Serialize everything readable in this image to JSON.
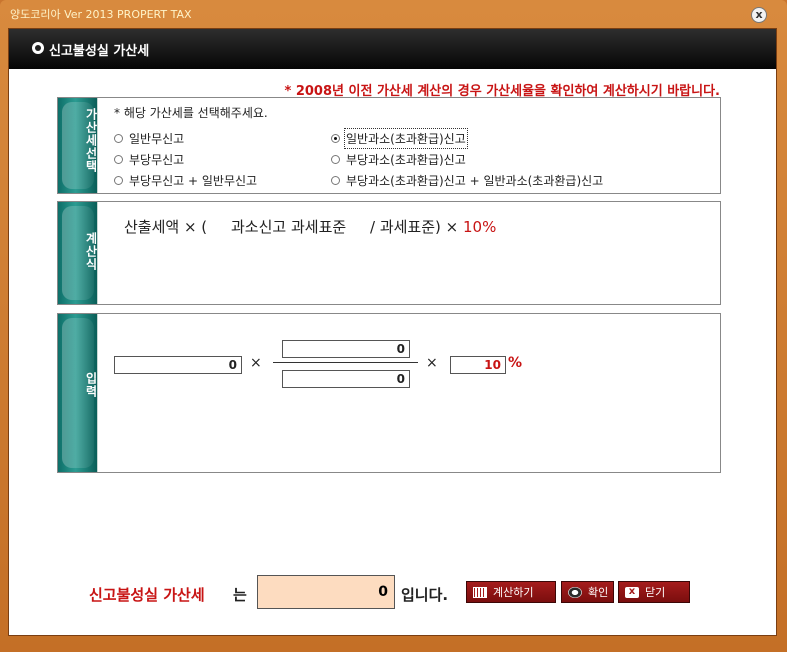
{
  "window": {
    "title": "양도코리아 Ver 2013 PROPERT TAX",
    "close_glyph": "x"
  },
  "header": {
    "title": "신고불성실 가산세"
  },
  "notice": "* 2008년 이전 가산세 계산의 경우 가산세율을 확인하여 계산하시기 바랍니다.",
  "selection_panel": {
    "tab_label": "가산세선택",
    "instruction": "* 해당 가산세를 선택해주세요.",
    "options": [
      {
        "label": "일반무신고",
        "checked": false
      },
      {
        "label": "일반과소(초과환급)신고",
        "checked": true
      },
      {
        "label": "부당무신고",
        "checked": false
      },
      {
        "label": "부당과소(초과환급)신고",
        "checked": false
      },
      {
        "label": "부당무신고 + 일반무신고",
        "checked": false
      },
      {
        "label": "부당과소(초과환급)신고 + 일반과소(초과환급)신고",
        "checked": false
      }
    ]
  },
  "formula_panel": {
    "tab_label": "계산식",
    "formula_prefix": "산출세액 × (     과소신고 과세표준     / 과세표준) × ",
    "formula_rate": "10%"
  },
  "input_panel": {
    "tab_label": "입력",
    "tax_amount": "0",
    "multiply_1": "×",
    "numerator": "0",
    "denominator": "0",
    "multiply_2": "×",
    "rate_value": "10",
    "rate_unit": "%"
  },
  "footer": {
    "label": "신고불성실 가산세",
    "particle": "는",
    "result": "0",
    "suffix": "입니다.",
    "calculate_button": "계산하기",
    "confirm_button": "확인",
    "close_button": "닫기",
    "close_icon_glyph": "x"
  }
}
